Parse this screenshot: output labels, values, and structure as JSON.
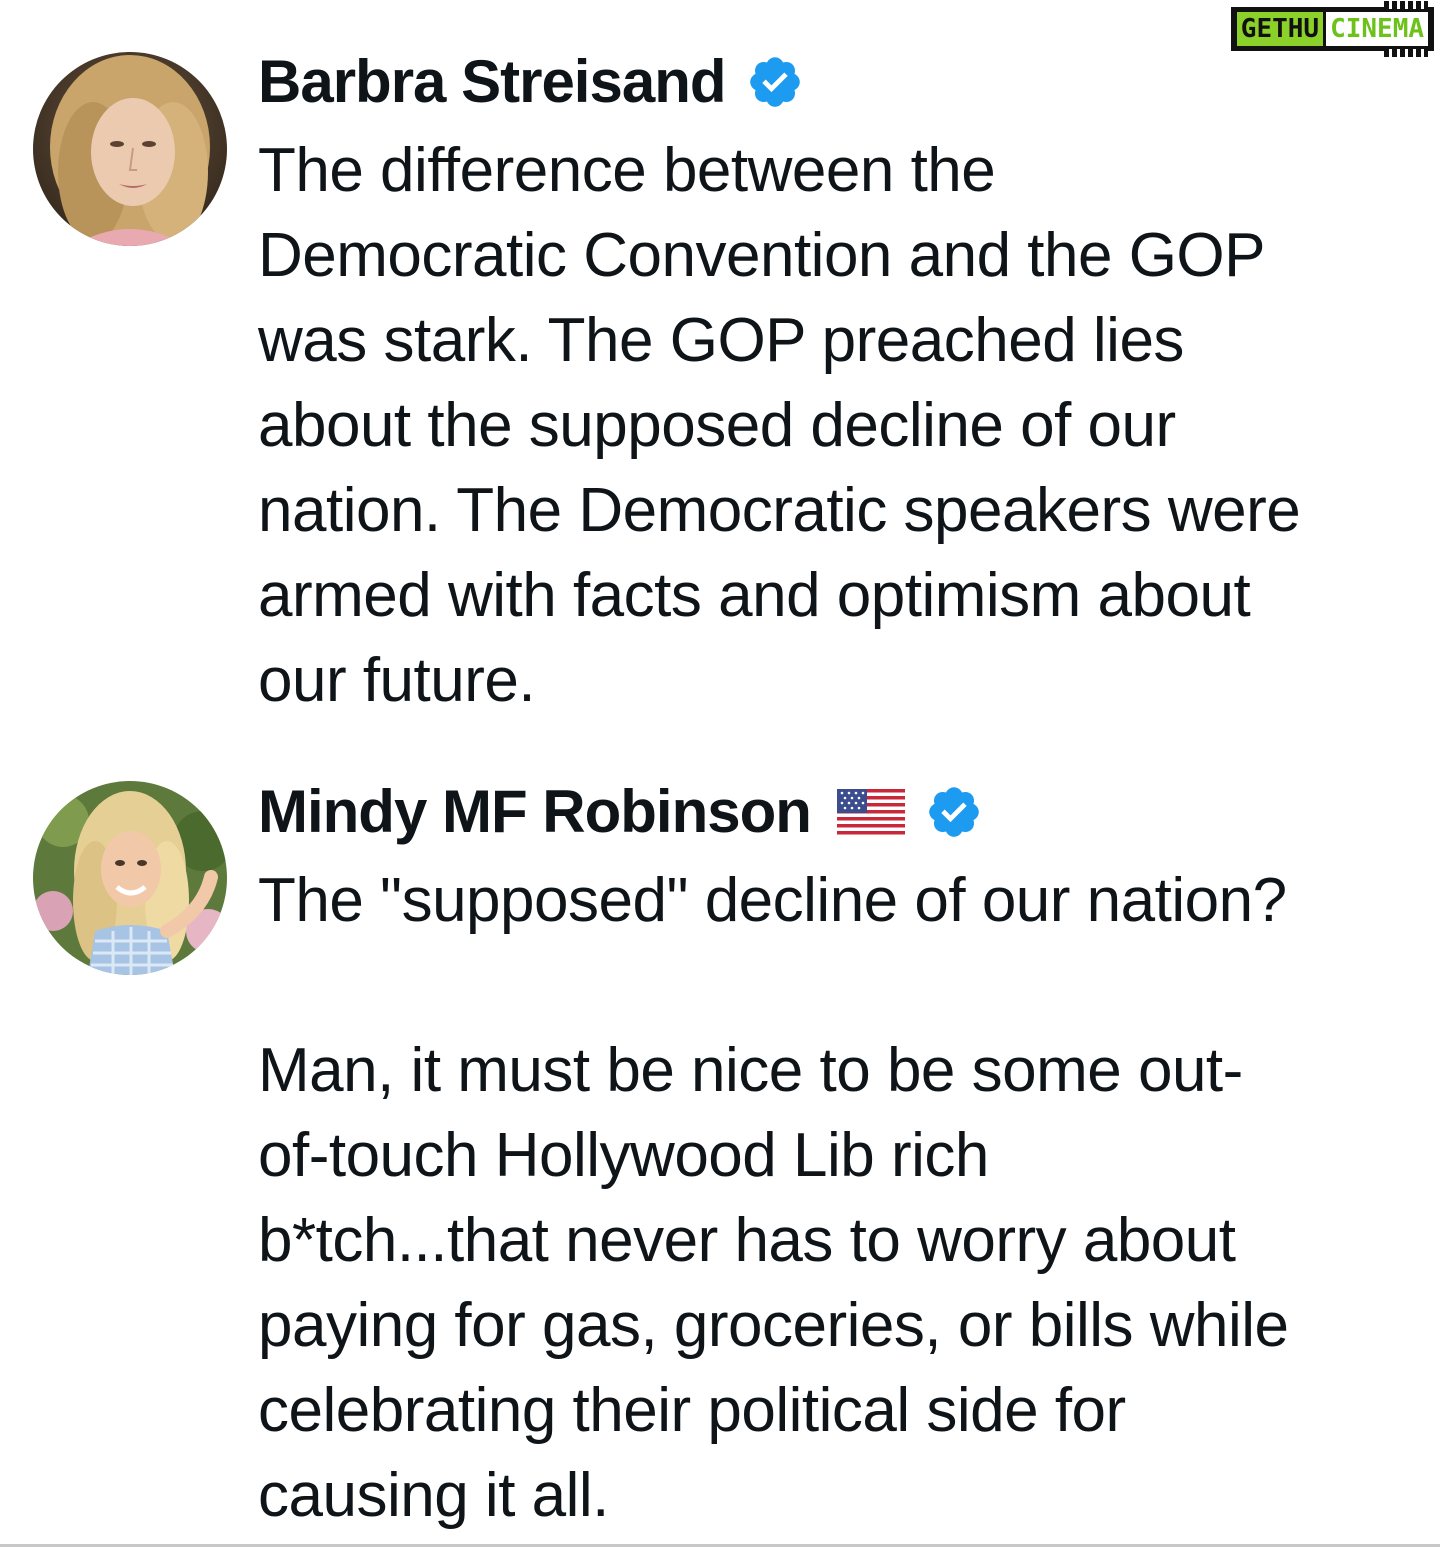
{
  "watermark": {
    "left": "GETHU",
    "right": "CINEMA"
  },
  "tweets": [
    {
      "author": "Barbra Streisand",
      "verified": true,
      "text": "The difference between the\nDemocratic Convention and the GOP\nwas stark. The GOP preached lies\nabout the supposed decline of our\nnation. The Democratic speakers were\narmed with facts and optimism about\nour future."
    },
    {
      "author": "Mindy MF Robinson",
      "flag": "us-flag-icon",
      "verified": true,
      "text": "The \"supposed\" decline of our nation?\n\nMan, it must be nice to be some out-\nof-touch Hollywood Lib rich\nb*tch...that never has to worry about\npaying for gas, groceries, or bills while\ncelebrating their political side for\ncausing it all."
    }
  ],
  "colors": {
    "text": "#0f1419",
    "verified": "#1d9bf0",
    "watermark_green": "#8bd12a"
  }
}
